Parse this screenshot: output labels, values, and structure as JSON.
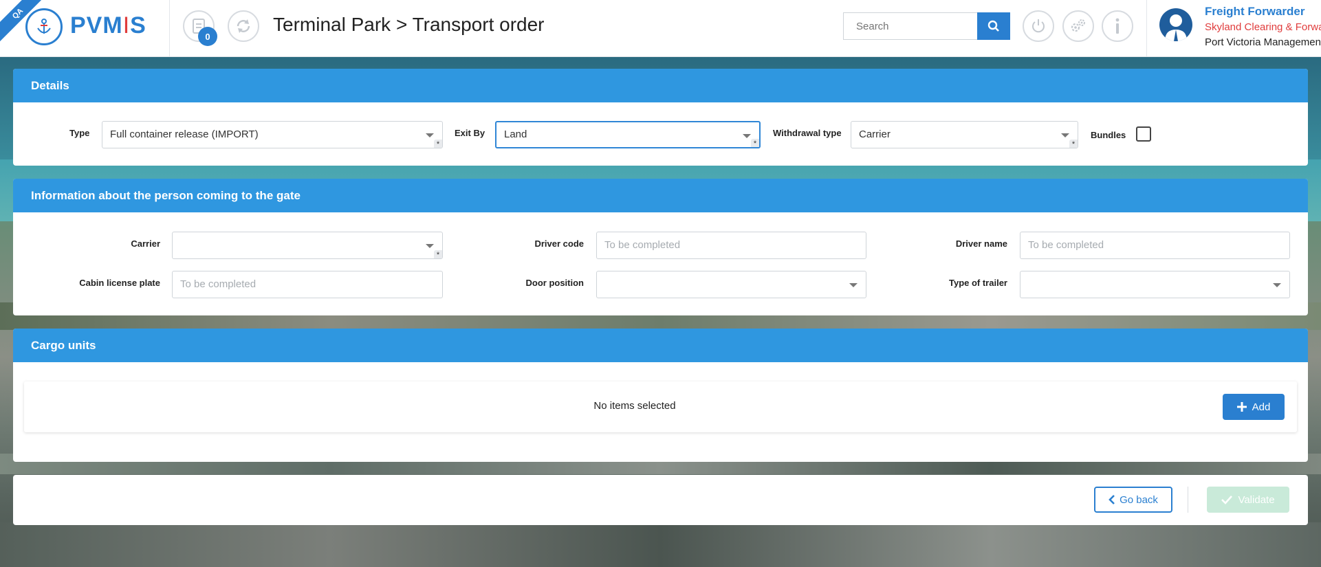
{
  "app": {
    "env_tag": "QA",
    "logo_text_left": "PVM",
    "logo_text_mid": "I",
    "logo_text_right": "S",
    "notification_count": "0",
    "page_title": "Terminal Park > Transport order",
    "search_placeholder": "Search",
    "colors": {
      "brand": "#2a7fd0",
      "section_header": "#2f97e0",
      "accent_red": "#e03c3c"
    }
  },
  "user": {
    "role": "Freight Forwarder",
    "company": "Skyland Clearing & Forwarding",
    "organization": "Port Victoria Management"
  },
  "details": {
    "title": "Details",
    "type_label": "Type",
    "type_value": "Full container release (IMPORT)",
    "exit_by_label": "Exit By",
    "exit_by_value": "Land",
    "withdrawal_label": "Withdrawal type",
    "withdrawal_value": "Carrier",
    "bundles_label": "Bundles",
    "required_mark": "*"
  },
  "gate_person": {
    "title": "Information about the person coming to the gate",
    "carrier_label": "Carrier",
    "carrier_value": "",
    "driver_code_label": "Driver code",
    "driver_code_placeholder": "To be completed",
    "driver_name_label": "Driver name",
    "driver_name_placeholder": "To be completed",
    "cabin_plate_label": "Cabin license plate",
    "cabin_plate_placeholder": "To be completed",
    "door_position_label": "Door position",
    "door_position_value": "",
    "trailer_type_label": "Type of trailer",
    "trailer_type_value": ""
  },
  "cargo": {
    "title": "Cargo units",
    "empty_text": "No items selected",
    "add_label": "Add"
  },
  "footer": {
    "back_label": "Go back",
    "validate_label": "Validate"
  }
}
